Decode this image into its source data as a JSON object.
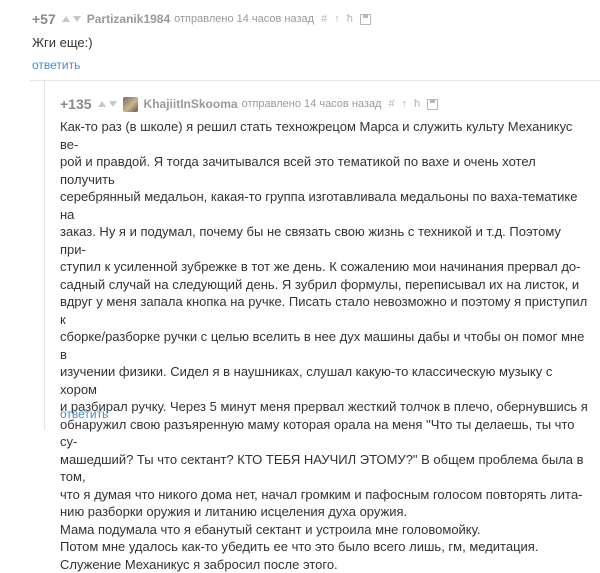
{
  "comment1": {
    "score": "+57",
    "author": "Partizanik1984",
    "sent": "отправлено 14 часов назад",
    "icons": [
      "hash-icon",
      "pin-icon",
      "tree-icon",
      "save-icon"
    ],
    "text": "Жги еще:)",
    "reply": "ответить"
  },
  "comment2": {
    "score": "+135",
    "author": "KhajiitInSkooma",
    "sent": "отправлено 14 часов назад",
    "lines": [
      "Как-то раз (в школе) я решил стать техножрецом Марса и служить культу Механикус ве-",
      "рой и правдой. Я тогда зачитывался всей это тематикой по вахе и очень хотел получить",
      "серебрянный медальон, какая-то группа изготавливала медальоны по ваха-тематике на",
      "заказ. Ну я и подумал, почему бы не связать свою жизнь с техникой и т.д. Поэтому при-",
      "ступил к усиленной зубрежке в тот же день. К сожалению мои начинания прервал до-",
      "садный случай на следующий день. Я зубрил формулы, переписывал их на листок, и",
      "вдруг у меня запала кнопка на ручке. Писать стало невозможно и поэтому я приступил к",
      "сборке/разборке ручки с целью вселить в нее дух машины дабы и чтобы он помог мне в",
      "изучении физики. Сидел я в наушниках, слушал какую-то классическую музыку с хором",
      "и разбирал ручку. Через 5 минут меня прервал жесткий толчок в плечо, обернувшись я",
      "обнаружил свою разъяренную маму которая орала на меня \"Что ты делаешь, ты что су-",
      "машедший? Ты что сектант? КТО ТЕБЯ НАУЧИЛ ЭТОМУ?\" В общем проблема была в том,",
      "что я думая что никого дома нет, начал громким и пафосным голосом повторять литa-",
      "нию разборки оружия и литанию исцеления духа оружия.",
      "Мама подумала что я ебанутый сектант и устроила мне головомойку.",
      "Потом мне удалось как-то убедить ее что это было всего лишь, гм, медитация.",
      "Служение Механикус я забросил после этого."
    ],
    "reply": "ответить"
  }
}
